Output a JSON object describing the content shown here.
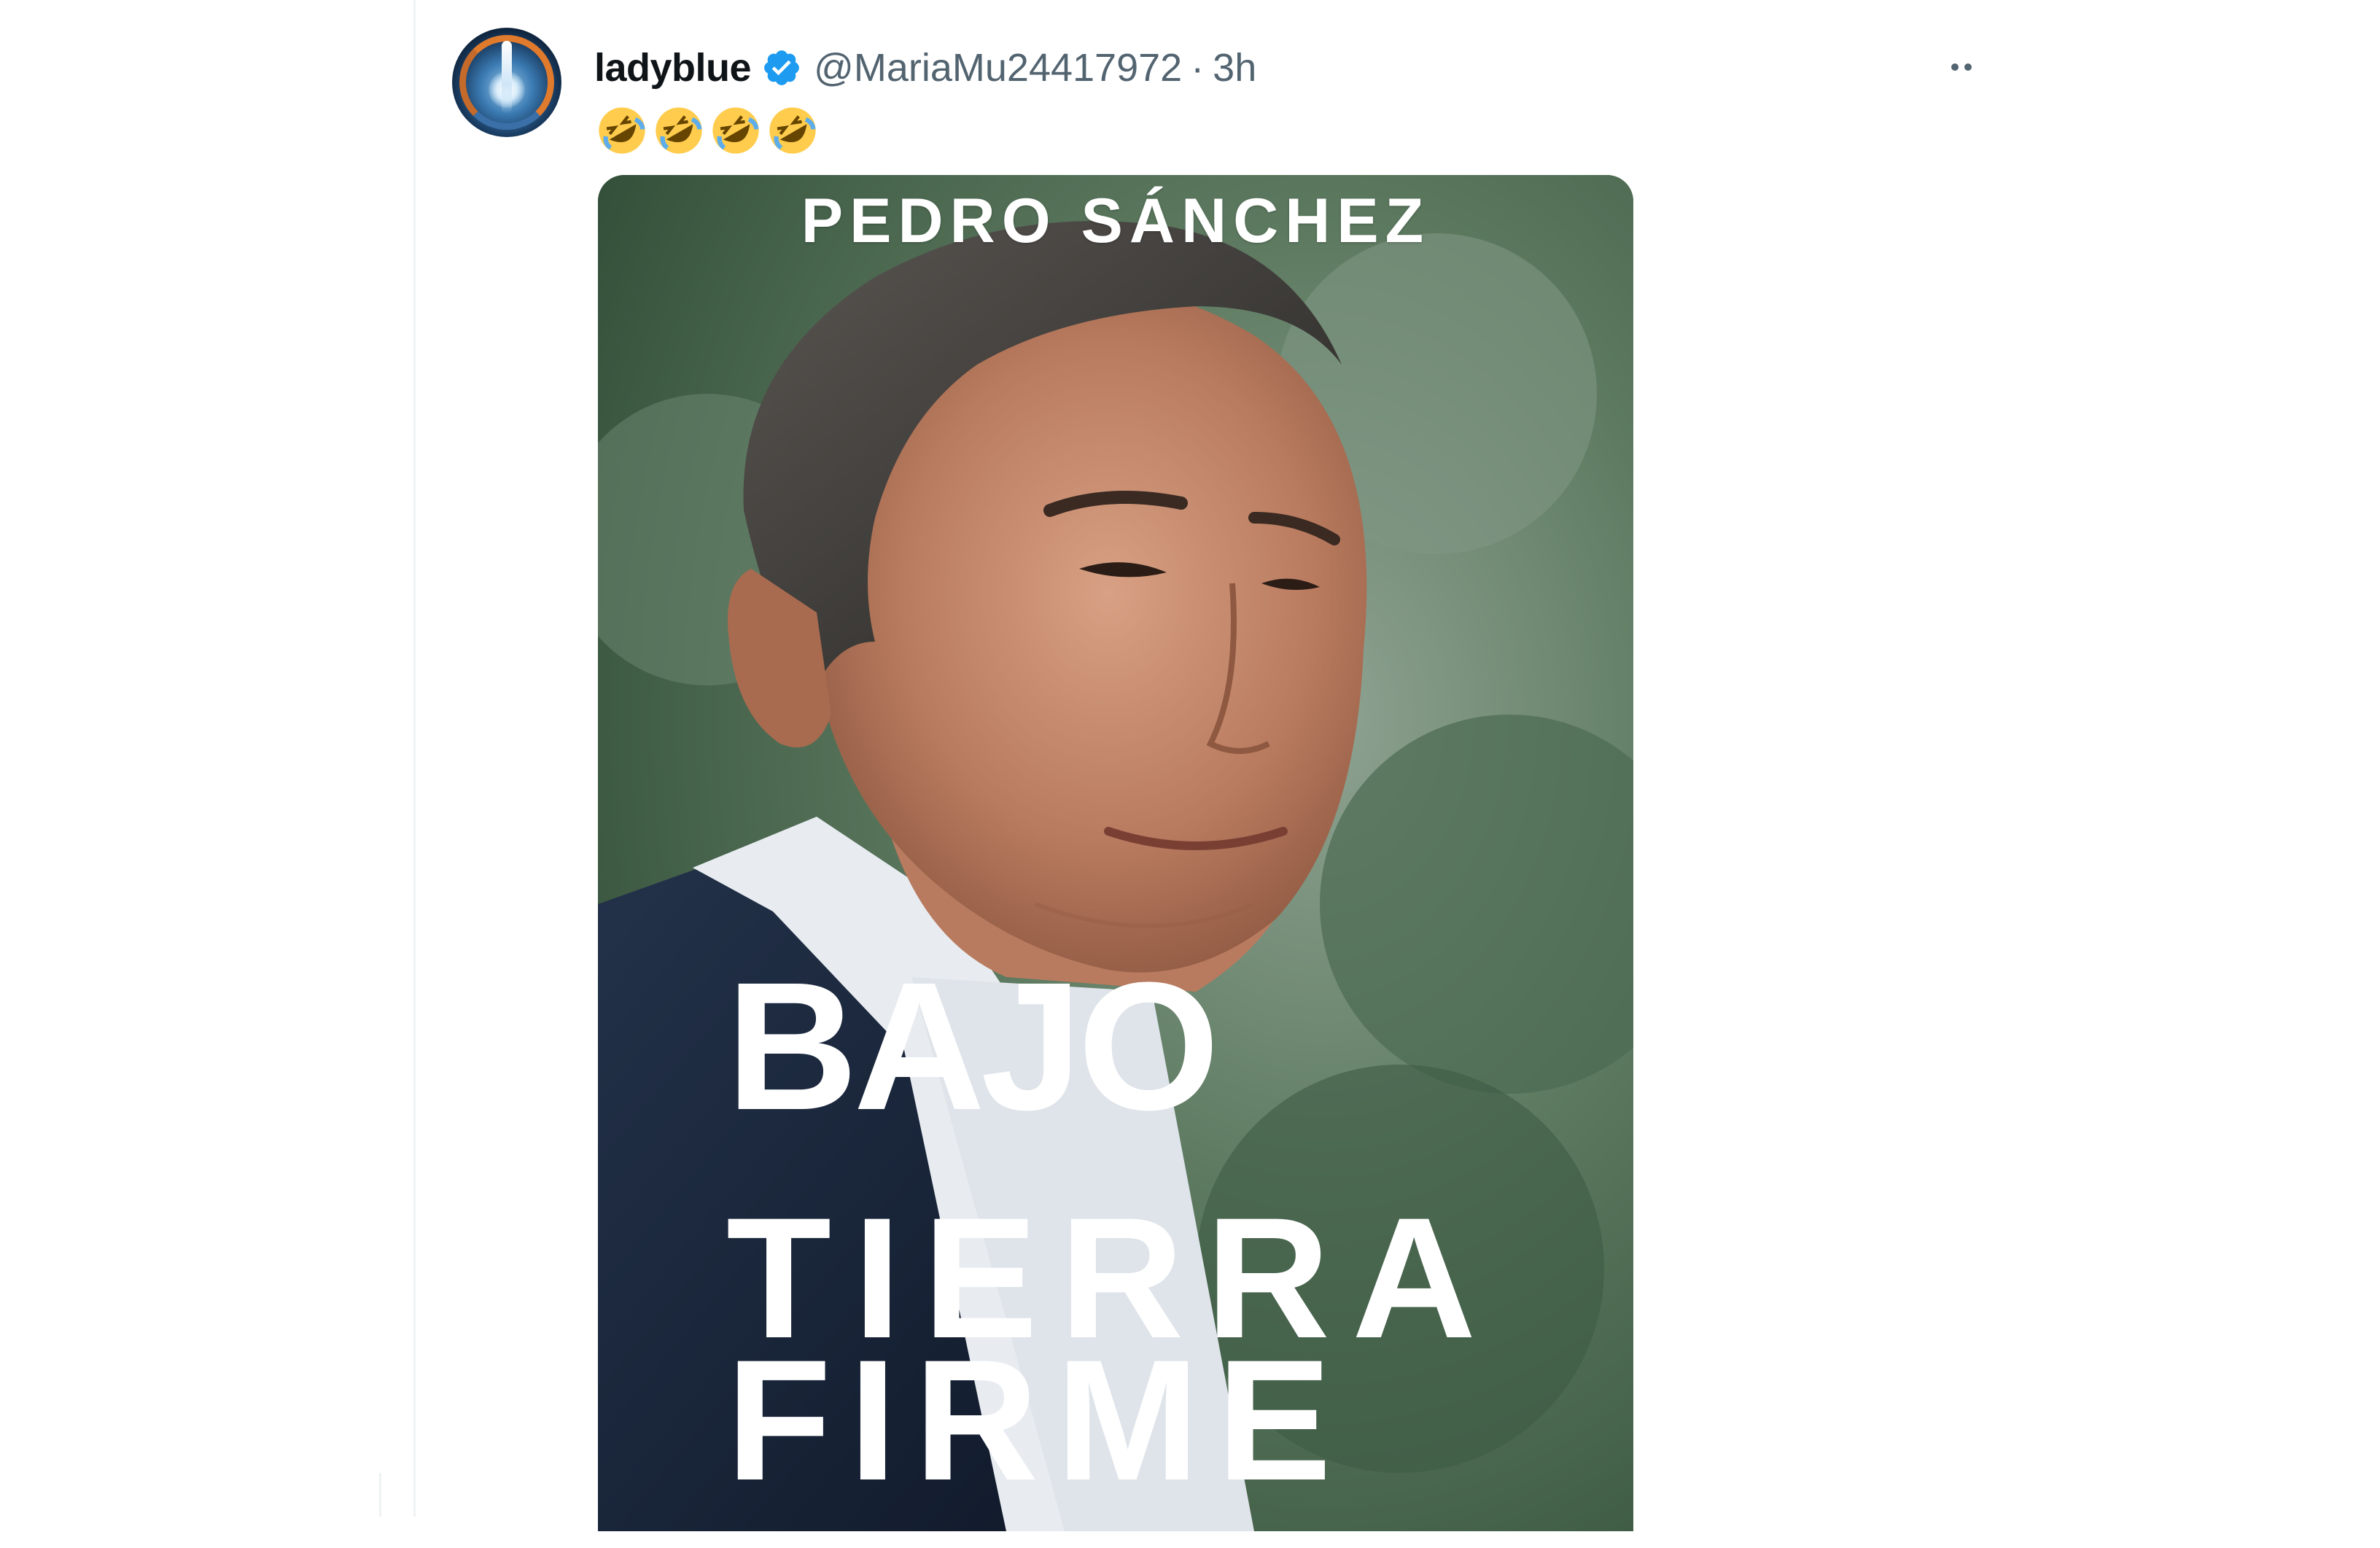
{
  "tweet": {
    "display_name": "ladyblue",
    "handle": "@MariaMu24417972",
    "separator": "·",
    "timestamp": "3h",
    "text_emojis": [
      "🤣",
      "🤣",
      "🤣",
      "🤣"
    ],
    "more_icon": "more-horizontal-icon",
    "verified_icon": "verified-badge-icon"
  },
  "media": {
    "author": "PEDRO SÁNCHEZ",
    "title_lines": [
      "BAJO",
      "TIERRA",
      "FIRME"
    ]
  },
  "colors": {
    "name_text": "#0f1419",
    "secondary_text": "#536471",
    "verified_blue": "#1d9bf0",
    "background": "#ffffff"
  }
}
